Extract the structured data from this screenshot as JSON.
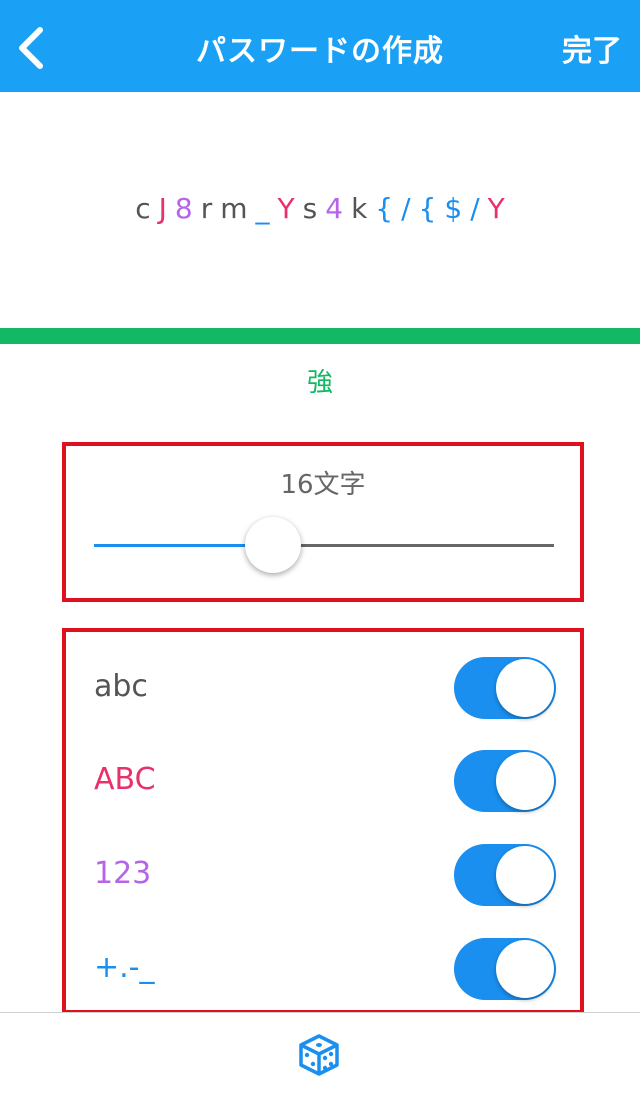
{
  "navbar": {
    "title": "パスワードの作成",
    "done_label": "完了",
    "back_icon": "chevron-left-icon",
    "background": "#1aa0f5"
  },
  "password": {
    "chars": [
      {
        "ch": "c",
        "color": "#555555"
      },
      {
        "ch": "J",
        "color": "#e8316a"
      },
      {
        "ch": "8",
        "color": "#b665e8"
      },
      {
        "ch": "r",
        "color": "#555555"
      },
      {
        "ch": "m",
        "color": "#555555"
      },
      {
        "ch": "_",
        "color": "#1a8fef"
      },
      {
        "ch": "Y",
        "color": "#e8316a"
      },
      {
        "ch": "s",
        "color": "#555555"
      },
      {
        "ch": "4",
        "color": "#b665e8"
      },
      {
        "ch": "k",
        "color": "#555555"
      },
      {
        "ch": "{",
        "color": "#1a8fef"
      },
      {
        "ch": "/",
        "color": "#1a8fef"
      },
      {
        "ch": "{",
        "color": "#1a8fef"
      },
      {
        "ch": "$",
        "color": "#1a8fef"
      },
      {
        "ch": "/",
        "color": "#1a8fef"
      },
      {
        "ch": "Y",
        "color": "#e8316a"
      }
    ]
  },
  "strength": {
    "label": "強",
    "color": "#12b864"
  },
  "length": {
    "label": "16文字",
    "slider_fraction": 0.39
  },
  "options": [
    {
      "label": "abc",
      "color": "#555555",
      "enabled": true
    },
    {
      "label": "ABC",
      "color": "#e8316a",
      "enabled": true
    },
    {
      "label": "123",
      "color": "#b665e8",
      "enabled": true
    },
    {
      "label": "+.-_",
      "color": "#1a8fef",
      "enabled": true
    }
  ],
  "bottom_bar": {
    "generate_icon": "dice-icon"
  }
}
